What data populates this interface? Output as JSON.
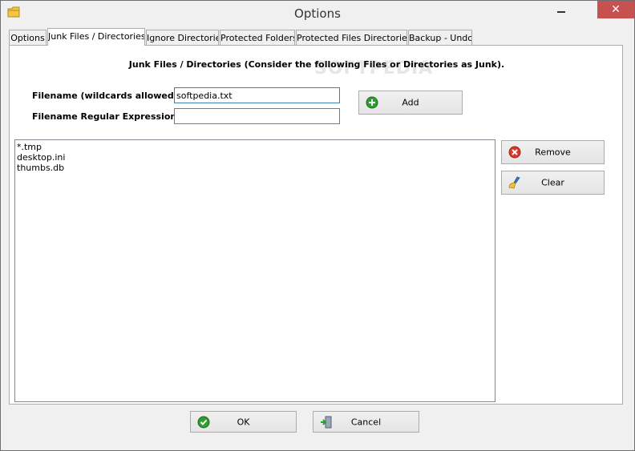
{
  "window": {
    "title": "Options"
  },
  "tabs": [
    {
      "label": "Options",
      "active": false
    },
    {
      "label": "Junk Files / Directories",
      "active": true
    },
    {
      "label": "Ignore Directories",
      "active": false
    },
    {
      "label": "Protected Folders",
      "active": false
    },
    {
      "label": "Protected Files  Directories",
      "active": false
    },
    {
      "label": "Backup - Undo",
      "active": false
    }
  ],
  "panel": {
    "heading": "Junk Files / Directories (Consider the following Files or Directories as Junk).",
    "watermark": "SOFTPEDIA",
    "filename_label": "Filename (wildcards allowed) :",
    "filename_value": "softpedia.txt",
    "regex_label": "Filename Regular Expression :",
    "regex_value": "",
    "add_label": "Add",
    "remove_label": "Remove",
    "clear_label": "Clear",
    "items": [
      "*.tmp",
      "desktop.ini",
      "thumbs.db"
    ]
  },
  "footer": {
    "ok_label": "OK",
    "cancel_label": "Cancel"
  },
  "colors": {
    "close_button": "#c75050",
    "focus_border": "#3c7fb1",
    "add_icon": "#2e9e2e",
    "remove_icon": "#d93a2b"
  }
}
